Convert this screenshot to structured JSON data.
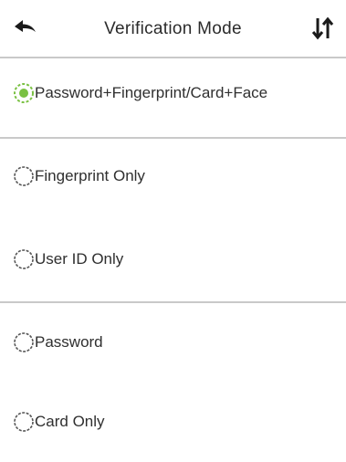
{
  "header": {
    "title": "Verification Mode",
    "back_icon": "back-arrow-icon",
    "sort_icon": "sort-arrows-icon"
  },
  "options": [
    {
      "label": "Password+Fingerprint/Card+Face",
      "selected": true
    },
    {
      "label": "Fingerprint Only",
      "selected": false
    },
    {
      "label": "User ID Only",
      "selected": false
    },
    {
      "label": "Password",
      "selected": false
    },
    {
      "label": "Card Only",
      "selected": false
    }
  ],
  "colors": {
    "selected": "#7ac143",
    "unselected": "#555555",
    "divider": "#c9c9c9"
  }
}
